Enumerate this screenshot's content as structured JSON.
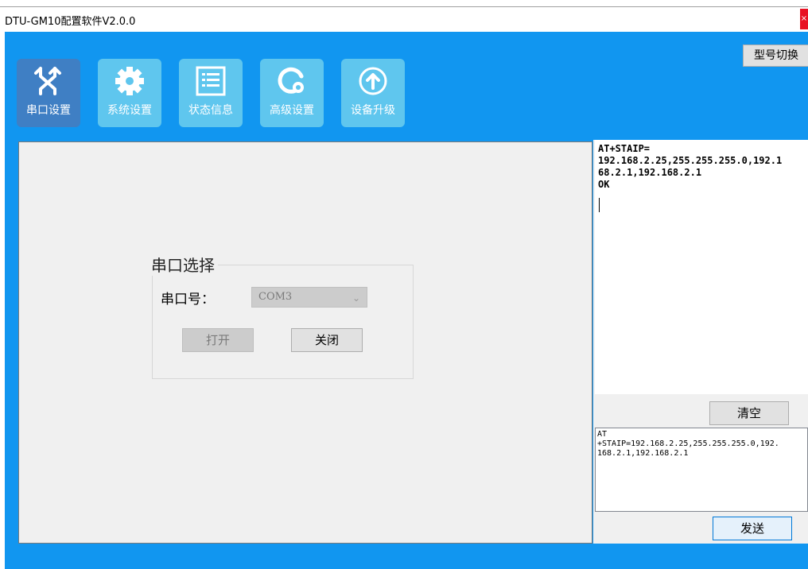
{
  "window": {
    "title": "DTU-GM10配置软件V2.0.0",
    "close_label": "×"
  },
  "toolbar": {
    "model_switch_label": "型号切换",
    "nav": [
      {
        "label": "串口设置",
        "icon": "swap-arrows-icon",
        "active": true
      },
      {
        "label": "系统设置",
        "icon": "gear-icon",
        "active": false
      },
      {
        "label": "状态信息",
        "icon": "list-icon",
        "active": false
      },
      {
        "label": "高级设置",
        "icon": "advanced-gear-icon",
        "active": false
      },
      {
        "label": "设备升级",
        "icon": "upload-arrow-icon",
        "active": false
      }
    ]
  },
  "serial": {
    "group_title": "串口选择",
    "port_label": "串口号：",
    "port_value": "COM3",
    "open_label": "打开",
    "close_label": "关闭"
  },
  "console": {
    "received_text": "AT+STAIP=\n192.168.2.25,255.255.255.0,192.1\n68.2.1,192.168.2.1\nOK",
    "clear_label": "清空",
    "send_text": "AT\n+STAIP=192.168.2.25,255.255.255.0,192.\n168.2.1,192.168.2.1",
    "send_label": "发送"
  },
  "colors": {
    "main_bg": "#1196f0",
    "nav_active": "#3f7fc4",
    "nav_inactive": "#5fc6ee"
  }
}
